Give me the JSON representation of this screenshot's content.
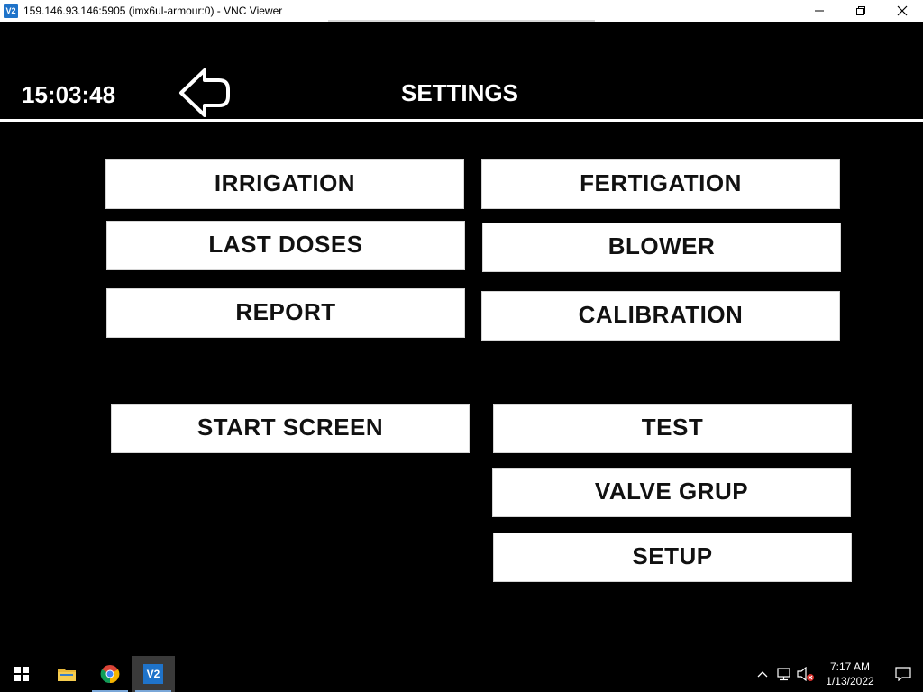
{
  "window": {
    "title": "159.146.93.146:5905 (imx6ul-armour:0) - VNC Viewer",
    "app_icon_text": "V2",
    "minimize_label": "—",
    "maximize_label": "❐",
    "close_label": "✕"
  },
  "screen": {
    "clock": "15:03:48",
    "title": "SETTINGS",
    "buttons": {
      "irrigation": "IRRIGATION",
      "fertigation": "FERTIGATION",
      "last_doses": "LAST DOSES",
      "blower": "BLOWER",
      "report": "REPORT",
      "calibration": "CALIBRATION",
      "start_screen": "START SCREEN",
      "test": "TEST",
      "valve_grup": "VALVE GRUP",
      "setup": "SETUP"
    }
  },
  "taskbar": {
    "time": "7:17 AM",
    "date": "1/13/2022",
    "vnc_icon_text": "V2"
  },
  "colors": {
    "background": "#000000",
    "button": "#ffffff",
    "button_text": "#111111",
    "vnc_blue": "#1f73c9"
  }
}
